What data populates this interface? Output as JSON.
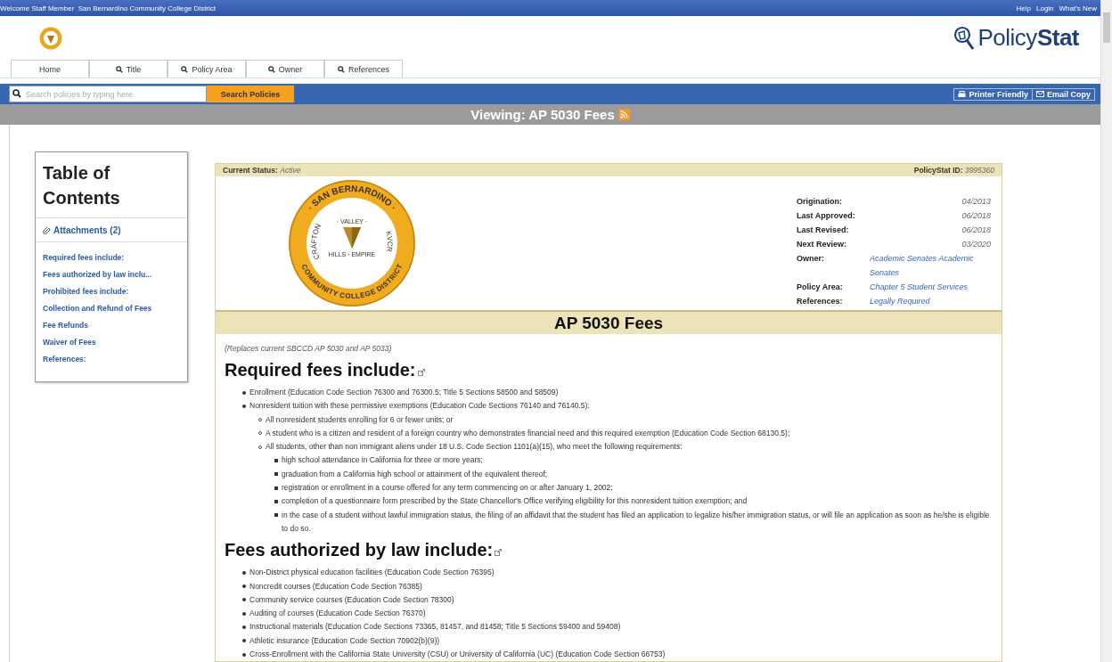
{
  "top_bar": {
    "welcome": "Welcome Staff Member",
    "organization": "San Bernardino Community College District",
    "links": [
      "Help",
      "Login",
      "What's New"
    ]
  },
  "brand": {
    "logo_text": "Policy**Stat**"
  },
  "nav_tabs": [
    {
      "label": "Home",
      "search_icon": false
    },
    {
      "label": "Title",
      "search_icon": true
    },
    {
      "label": "Policy Area",
      "search_icon": true
    },
    {
      "label": "Owner",
      "search_icon": true
    },
    {
      "label": "References",
      "search_icon": true
    }
  ],
  "search": {
    "placeholder": "Search policies by typing here",
    "button": "Search Policies"
  },
  "actions": [
    {
      "label": "Printer Friendly",
      "kind": "print"
    },
    {
      "label": "Email Copy",
      "kind": "email"
    }
  ],
  "viewing_bar": {
    "title": "Viewing: AP 5030 Fees"
  },
  "toc": {
    "title": "Table of Contents",
    "attachments": "Attachments (2)",
    "items": [
      "Required fees include:",
      "Fees authorized by law inclu...",
      "Prohibited fees include:",
      "Collection and Refund of Fees",
      "Fee Refunds",
      "Waiver of Fees",
      "References:"
    ]
  },
  "document": {
    "status_label": "Current Status:",
    "status_value": "Active",
    "id_label": "PolicyStat ID:",
    "id_value": "3995360",
    "seal": {
      "outer_top": "· SAN BERNARDINO ·",
      "inner_top": "· VALLEY ·",
      "inner_left": "CRAFTON",
      "inner_right": "KVCR",
      "inner_bottom": "HILLS · EMPIRE",
      "outer_bottom": "COMMUNITY COLLEGE DISTRICT"
    },
    "meta": [
      {
        "label": "Origination:",
        "value": "04/2013",
        "kind": "date"
      },
      {
        "label": "Last Approved:",
        "value": "06/2018",
        "kind": "date"
      },
      {
        "label": "Last Revised:",
        "value": "06/2018",
        "kind": "date"
      },
      {
        "label": "Next Review:",
        "value": "03/2020",
        "kind": "date"
      },
      {
        "label": "Owner:",
        "value": "Academic Senates Academic Senates",
        "kind": "link"
      },
      {
        "label": "Policy Area:",
        "value": "Chapter 5 Student Services",
        "kind": "link"
      },
      {
        "label": "References:",
        "value": "Legally Required",
        "kind": "link"
      }
    ],
    "title": "AP 5030 Fees",
    "note": "(Replaces current SBCCD AP 5030 and AP 5033)",
    "sections": [
      {
        "heading": "Required fees include:",
        "items": [
          {
            "text": "Enrollment (Education Code Section 76300 and 76300.5; Title 5 Sections 58500 and 58509)"
          },
          {
            "text": "Nonresident tuition with these permissive exemptions (Education Code Sections 76140 and 76140.5):",
            "children": [
              {
                "text": "All nonresident students enrolling for 6 or fewer units; or"
              },
              {
                "text": "A student who is a citizen and resident of a foreign country who demonstrates financial need and this required exemption (Education Code Section 68130.5);"
              },
              {
                "text": "All students, other than non immigrant aliens under 18 U.S. Code Section 1101(a)(15), who meet the following requirements:",
                "children": [
                  {
                    "text": "high school attendance in California for three or more years;"
                  },
                  {
                    "text": "graduation from a California high school or attainment of the equivalent thereof;"
                  },
                  {
                    "text": "registration or enrollment in a course offered for any term commencing on or after January 1, 2002;"
                  },
                  {
                    "text": "completion of a questionnaire form prescribed by the State Chancellor's Office verifying eligibility for this nonresident tuition exemption; and"
                  },
                  {
                    "text": "in the case of a student without lawful immigration status, the filing of an affidavit that the student has filed an application to legalize his/her immigration status, or will file an application as soon as he/she is eligible to do so."
                  }
                ]
              }
            ]
          }
        ]
      },
      {
        "heading": "Fees authorized by law include:",
        "items": [
          {
            "text": "Non-District physical education facilities (Education Code Section 76395)"
          },
          {
            "text": "Noncredit courses (Education Code Section 76385)"
          },
          {
            "text": "Community service courses (Education Code Section 78300)"
          },
          {
            "text": "Auditing of courses (Education Code Section 76370)"
          },
          {
            "text": "Instructional materials (Education Code Sections 73365, 81457, and 81458; Title 5 Sections 59400 and 59408)"
          },
          {
            "text": "Athletic insurance (Education Code Section 70902(b)(9))"
          },
          {
            "text": "Cross-Enrollment with the California State University (CSU) or University of California (UC) (Education Code Section 66753)"
          }
        ]
      }
    ]
  }
}
